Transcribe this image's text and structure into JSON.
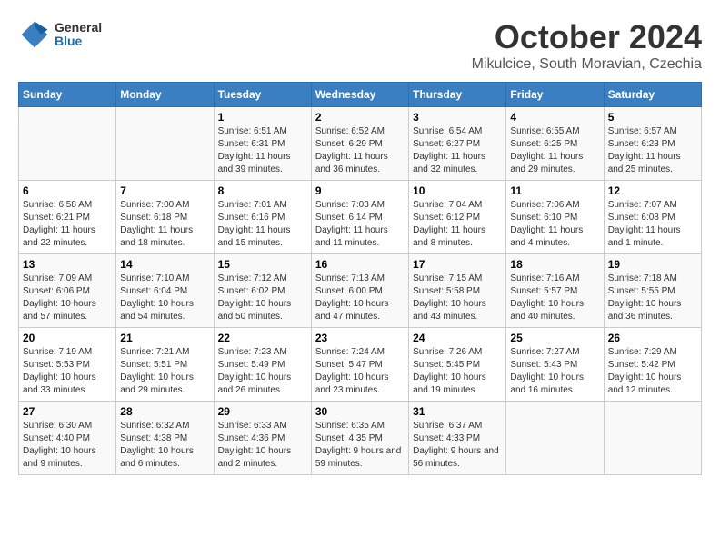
{
  "header": {
    "logo": {
      "general": "General",
      "blue": "Blue"
    },
    "title": "October 2024",
    "subtitle": "Mikulcice, South Moravian, Czechia"
  },
  "columns": [
    "Sunday",
    "Monday",
    "Tuesday",
    "Wednesday",
    "Thursday",
    "Friday",
    "Saturday"
  ],
  "weeks": [
    [
      {
        "day": "",
        "info": ""
      },
      {
        "day": "",
        "info": ""
      },
      {
        "day": "1",
        "info": "Sunrise: 6:51 AM\nSunset: 6:31 PM\nDaylight: 11 hours and 39 minutes."
      },
      {
        "day": "2",
        "info": "Sunrise: 6:52 AM\nSunset: 6:29 PM\nDaylight: 11 hours and 36 minutes."
      },
      {
        "day": "3",
        "info": "Sunrise: 6:54 AM\nSunset: 6:27 PM\nDaylight: 11 hours and 32 minutes."
      },
      {
        "day": "4",
        "info": "Sunrise: 6:55 AM\nSunset: 6:25 PM\nDaylight: 11 hours and 29 minutes."
      },
      {
        "day": "5",
        "info": "Sunrise: 6:57 AM\nSunset: 6:23 PM\nDaylight: 11 hours and 25 minutes."
      }
    ],
    [
      {
        "day": "6",
        "info": "Sunrise: 6:58 AM\nSunset: 6:21 PM\nDaylight: 11 hours and 22 minutes."
      },
      {
        "day": "7",
        "info": "Sunrise: 7:00 AM\nSunset: 6:18 PM\nDaylight: 11 hours and 18 minutes."
      },
      {
        "day": "8",
        "info": "Sunrise: 7:01 AM\nSunset: 6:16 PM\nDaylight: 11 hours and 15 minutes."
      },
      {
        "day": "9",
        "info": "Sunrise: 7:03 AM\nSunset: 6:14 PM\nDaylight: 11 hours and 11 minutes."
      },
      {
        "day": "10",
        "info": "Sunrise: 7:04 AM\nSunset: 6:12 PM\nDaylight: 11 hours and 8 minutes."
      },
      {
        "day": "11",
        "info": "Sunrise: 7:06 AM\nSunset: 6:10 PM\nDaylight: 11 hours and 4 minutes."
      },
      {
        "day": "12",
        "info": "Sunrise: 7:07 AM\nSunset: 6:08 PM\nDaylight: 11 hours and 1 minute."
      }
    ],
    [
      {
        "day": "13",
        "info": "Sunrise: 7:09 AM\nSunset: 6:06 PM\nDaylight: 10 hours and 57 minutes."
      },
      {
        "day": "14",
        "info": "Sunrise: 7:10 AM\nSunset: 6:04 PM\nDaylight: 10 hours and 54 minutes."
      },
      {
        "day": "15",
        "info": "Sunrise: 7:12 AM\nSunset: 6:02 PM\nDaylight: 10 hours and 50 minutes."
      },
      {
        "day": "16",
        "info": "Sunrise: 7:13 AM\nSunset: 6:00 PM\nDaylight: 10 hours and 47 minutes."
      },
      {
        "day": "17",
        "info": "Sunrise: 7:15 AM\nSunset: 5:58 PM\nDaylight: 10 hours and 43 minutes."
      },
      {
        "day": "18",
        "info": "Sunrise: 7:16 AM\nSunset: 5:57 PM\nDaylight: 10 hours and 40 minutes."
      },
      {
        "day": "19",
        "info": "Sunrise: 7:18 AM\nSunset: 5:55 PM\nDaylight: 10 hours and 36 minutes."
      }
    ],
    [
      {
        "day": "20",
        "info": "Sunrise: 7:19 AM\nSunset: 5:53 PM\nDaylight: 10 hours and 33 minutes."
      },
      {
        "day": "21",
        "info": "Sunrise: 7:21 AM\nSunset: 5:51 PM\nDaylight: 10 hours and 29 minutes."
      },
      {
        "day": "22",
        "info": "Sunrise: 7:23 AM\nSunset: 5:49 PM\nDaylight: 10 hours and 26 minutes."
      },
      {
        "day": "23",
        "info": "Sunrise: 7:24 AM\nSunset: 5:47 PM\nDaylight: 10 hours and 23 minutes."
      },
      {
        "day": "24",
        "info": "Sunrise: 7:26 AM\nSunset: 5:45 PM\nDaylight: 10 hours and 19 minutes."
      },
      {
        "day": "25",
        "info": "Sunrise: 7:27 AM\nSunset: 5:43 PM\nDaylight: 10 hours and 16 minutes."
      },
      {
        "day": "26",
        "info": "Sunrise: 7:29 AM\nSunset: 5:42 PM\nDaylight: 10 hours and 12 minutes."
      }
    ],
    [
      {
        "day": "27",
        "info": "Sunrise: 6:30 AM\nSunset: 4:40 PM\nDaylight: 10 hours and 9 minutes."
      },
      {
        "day": "28",
        "info": "Sunrise: 6:32 AM\nSunset: 4:38 PM\nDaylight: 10 hours and 6 minutes."
      },
      {
        "day": "29",
        "info": "Sunrise: 6:33 AM\nSunset: 4:36 PM\nDaylight: 10 hours and 2 minutes."
      },
      {
        "day": "30",
        "info": "Sunrise: 6:35 AM\nSunset: 4:35 PM\nDaylight: 9 hours and 59 minutes."
      },
      {
        "day": "31",
        "info": "Sunrise: 6:37 AM\nSunset: 4:33 PM\nDaylight: 9 hours and 56 minutes."
      },
      {
        "day": "",
        "info": ""
      },
      {
        "day": "",
        "info": ""
      }
    ]
  ]
}
